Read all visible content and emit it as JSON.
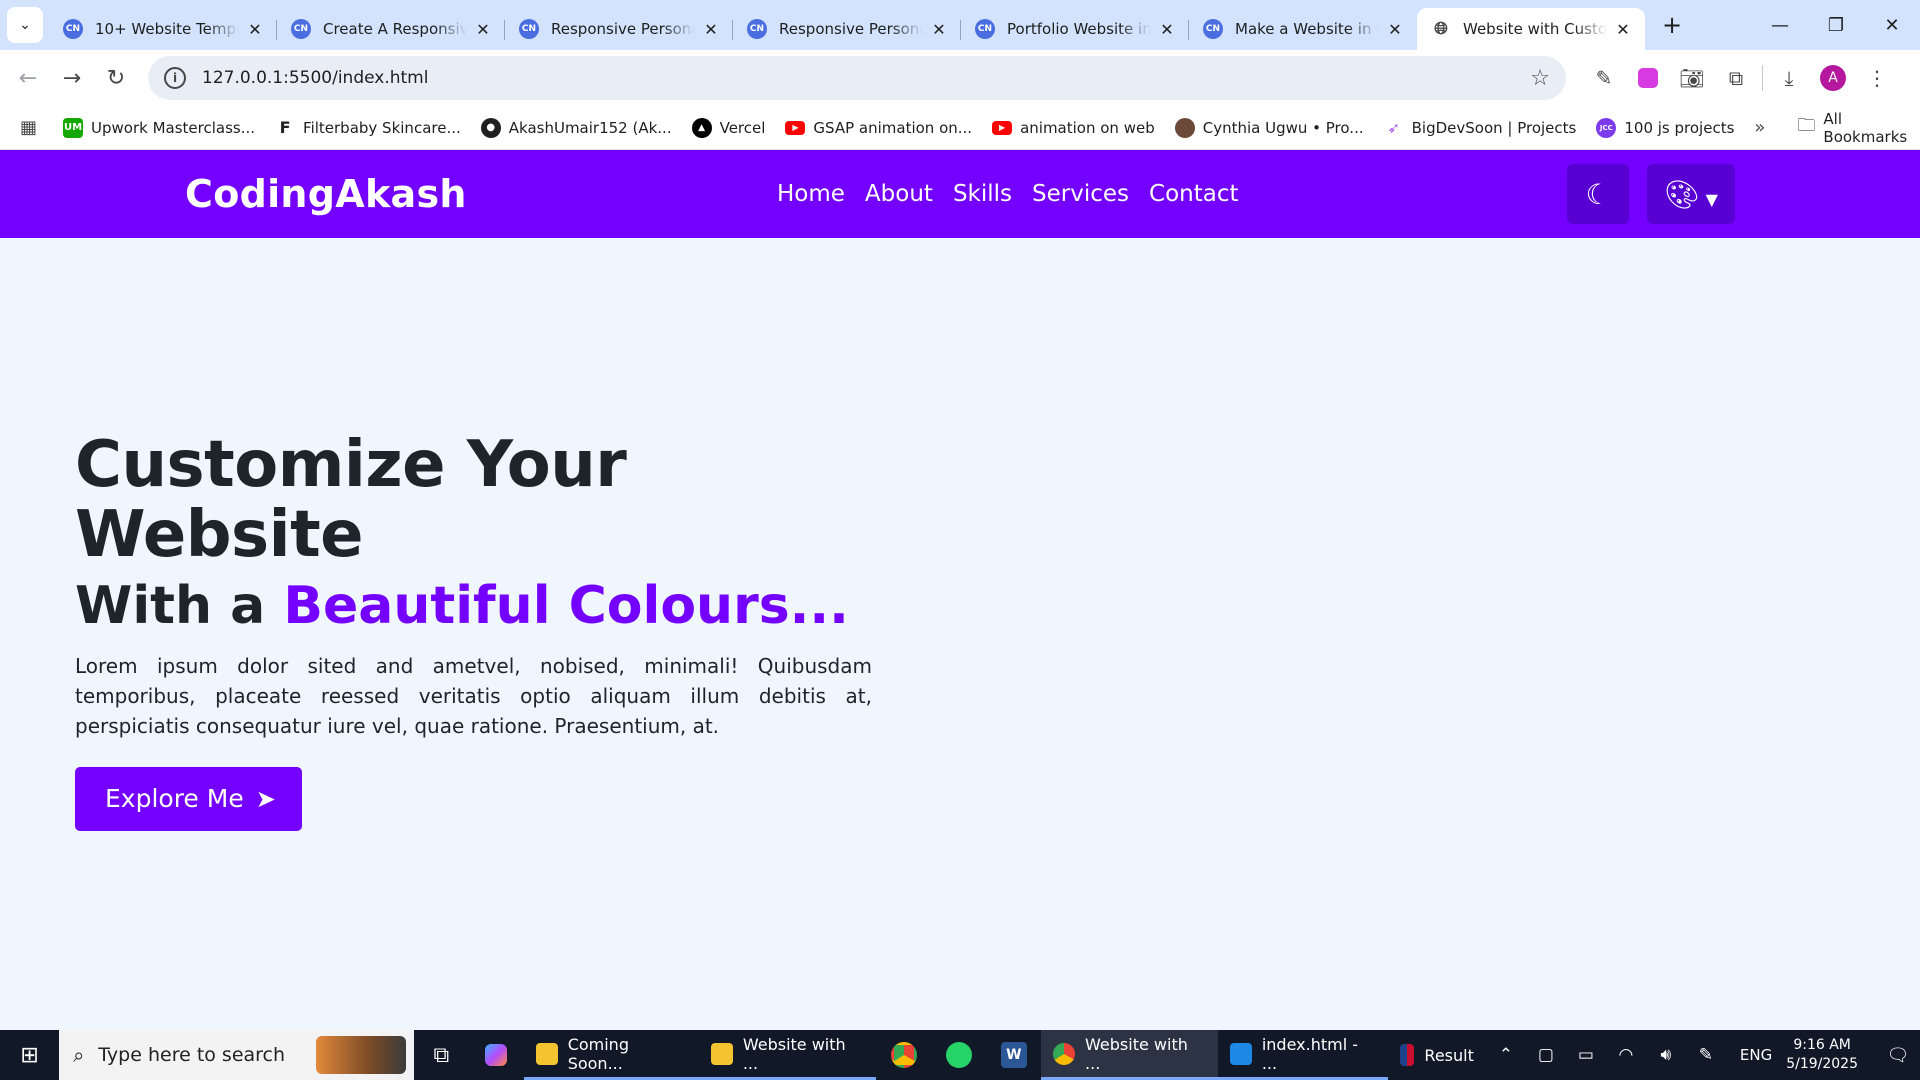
{
  "browser": {
    "tabs": [
      {
        "title": "10+ Website Templat",
        "favicon": "codingnepal-logo"
      },
      {
        "title": "Create A Responsive",
        "favicon": "codingnepal-logo"
      },
      {
        "title": "Responsive Personal",
        "favicon": "codingnepal-logo"
      },
      {
        "title": "Responsive Personal",
        "favicon": "codingnepal-logo"
      },
      {
        "title": "Portfolio Website in",
        "favicon": "codingnepal-logo"
      },
      {
        "title": "Make a Website in H",
        "favicon": "codingnepal-logo"
      },
      {
        "title": "Website with Custom",
        "favicon": "globe-icon",
        "active": true
      }
    ],
    "url": "127.0.0.1:5500/index.html",
    "bookmarks": [
      {
        "label": "Upwork Masterclass...",
        "icon": "UM",
        "color": "#14a800"
      },
      {
        "label": "Filterbaby Skincare...",
        "icon": "F",
        "color": "#222222"
      },
      {
        "label": "AkashUmair152 (Ak...",
        "icon": "github-icon",
        "color": "#1f1f1f"
      },
      {
        "label": "Vercel",
        "icon": "vercel-icon",
        "color": "#000000"
      },
      {
        "label": "GSAP animation on...",
        "icon": "youtube-icon",
        "color": "#ff0000"
      },
      {
        "label": "animation on web",
        "icon": "youtube-icon",
        "color": "#ff0000"
      },
      {
        "label": "Cynthia Ugwu • Pro...",
        "icon": "person-icon",
        "color": "#6b4a3a"
      },
      {
        "label": "BigDevSoon | Projects",
        "icon": "rocket-icon",
        "color": "#a855f7"
      },
      {
        "label": "100 js projects",
        "icon": "JCC",
        "color": "#7c3aed"
      }
    ],
    "all_bookmarks": "All Bookmarks",
    "avatar_letter": "A"
  },
  "site": {
    "logo": "CodingAkash",
    "nav": [
      "Home",
      "About",
      "Skills",
      "Services",
      "Contact"
    ],
    "accent_color": "#7400ff",
    "hero": {
      "title": "Customize Your Website",
      "subtitle_prefix": "With a ",
      "subtitle_accent": "Beautiful Colours...",
      "paragraph": "Lorem ipsum dolor sited and ametvel, nobised, minimali! Quibusdam temporibus, placeate reessed veritatis optio aliquam illum debitis at, perspiciatis consequatur iure vel, quae ratione. Praesentium, at.",
      "cta": "Explore Me"
    }
  },
  "taskbar": {
    "search_placeholder": "Type here to search",
    "apps": [
      {
        "label": "Coming Soon...",
        "icon": "folder-icon"
      },
      {
        "label": "Website with ...",
        "icon": "folder-icon"
      },
      {
        "label": "Website with ...",
        "icon": "chrome-icon",
        "active": true
      },
      {
        "label": "index.html - ...",
        "icon": "vscode-icon"
      },
      {
        "label": "Result",
        "icon": "nba-icon"
      }
    ],
    "language": "ENG",
    "time": "9:16 AM",
    "date": "5/19/2025"
  }
}
